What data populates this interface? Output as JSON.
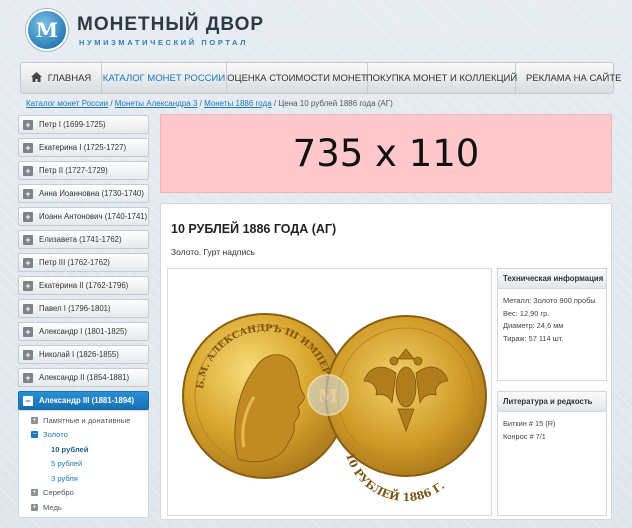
{
  "site": {
    "title": "МОНЕТНЫЙ ДВОР",
    "subtitle": "НУМИЗМАТИЧЕСКИЙ ПОРТАЛ",
    "logo_letter": "М"
  },
  "nav": [
    {
      "label": "ГЛАВНАЯ",
      "active": false
    },
    {
      "label": "КАТАЛОГ МОНЕТ РОССИИ",
      "active": true
    },
    {
      "label": "ОЦЕНКА СТОИМОСТИ МОНЕТ",
      "active": false
    },
    {
      "label": "ПОКУПКА МОНЕТ И КОЛЛЕКЦИЙ",
      "active": false
    },
    {
      "label": "РЕКЛАМА НА САЙТЕ",
      "active": false
    }
  ],
  "breadcrumb": {
    "links": [
      "Каталог монет России",
      "Монеты Александра 3",
      "Монеты 1886 года"
    ],
    "current": "Цена 10 рублей 1886 года (АГ)",
    "separator": " / "
  },
  "sidebar": {
    "items": [
      "Петр I (1699-1725)",
      "Екатерина I (1725-1727)",
      "Петр II (1727-1729)",
      "Анна Иоанновна (1730-1740)",
      "Иоанн Антонович (1740-1741)",
      "Елизавета (1741-1762)",
      "Петр III (1762-1762)",
      "Екатерина II (1762-1796)",
      "Павел I (1796-1801)",
      "Александр I (1801-1825)",
      "Николай I (1826-1855)",
      "Александр II (1854-1881)"
    ],
    "active": "Александр III (1881-1894)",
    "subtree": {
      "memorial": "Памятные и донативные",
      "gold": "Золото",
      "gold_children": [
        "10 рублей",
        "5 рублей",
        "3 рубля"
      ],
      "silver": "Серебро",
      "copper": "Медь"
    }
  },
  "banner": {
    "text": "735 x 110"
  },
  "coin": {
    "title": "10 РУБЛЕЙ 1886 ГОДА (АГ)",
    "description": "Золото. Гурт надпись",
    "obverse_legend": "Б.М. АЛЕКСАНДРЪ III ИМПЕРАТОРЪ И САМОДЕРЖ. ВСЕРОСС.",
    "reverse_legend": "10 РУБЛЕЙ 1886 Г.",
    "watermark_letter": "М"
  },
  "tech_info": {
    "title": "Техническая информация",
    "rows": [
      "Металл:  Золото 900 пробы",
      "Вес: 12,90 гр.",
      "Диаметр:  24,6 мм",
      "Тираж:  57 114 шт."
    ]
  },
  "literature": {
    "title": "Литература и редкость",
    "rows": [
      "Биткин # 15 (R)",
      "Конрос # 7/1"
    ]
  },
  "colors": {
    "accent": "#1b77b8",
    "gold": "#d9a62e",
    "banner_bg": "#ffc8cc"
  },
  "icons": {
    "home": "home-icon",
    "expand": "plus-icon",
    "collapse": "minus-icon"
  }
}
